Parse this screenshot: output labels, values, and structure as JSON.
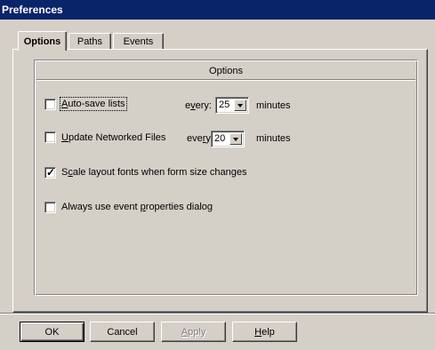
{
  "window": {
    "title": "Preferences"
  },
  "tabs": [
    {
      "label": "Options",
      "active": true
    },
    {
      "label": "Paths",
      "active": false
    },
    {
      "label": "Events",
      "active": false
    }
  ],
  "group": {
    "title": "Options"
  },
  "options": {
    "autosave": {
      "label": "Auto-save lists",
      "checked": false,
      "every_label": "every:",
      "value": "25",
      "unit": "minutes"
    },
    "update_networked": {
      "label": "Update Networked Files",
      "checked": false,
      "every_label": "every:",
      "value": "20",
      "unit": "minutes"
    },
    "scale_fonts": {
      "label": "Scale layout fonts when form size changes",
      "checked": true
    },
    "event_dialog": {
      "label": "Always use event properties dialog",
      "checked": false
    }
  },
  "buttons": {
    "ok": "OK",
    "cancel": "Cancel",
    "apply": "Apply",
    "help": "Help"
  },
  "icons": {
    "check": "check-icon",
    "dropdown": "chevron-down-icon"
  },
  "colors": {
    "titlebar": "#0a246a",
    "face": "#d4d0c8",
    "shadow": "#808080",
    "highlight": "#ffffff"
  }
}
